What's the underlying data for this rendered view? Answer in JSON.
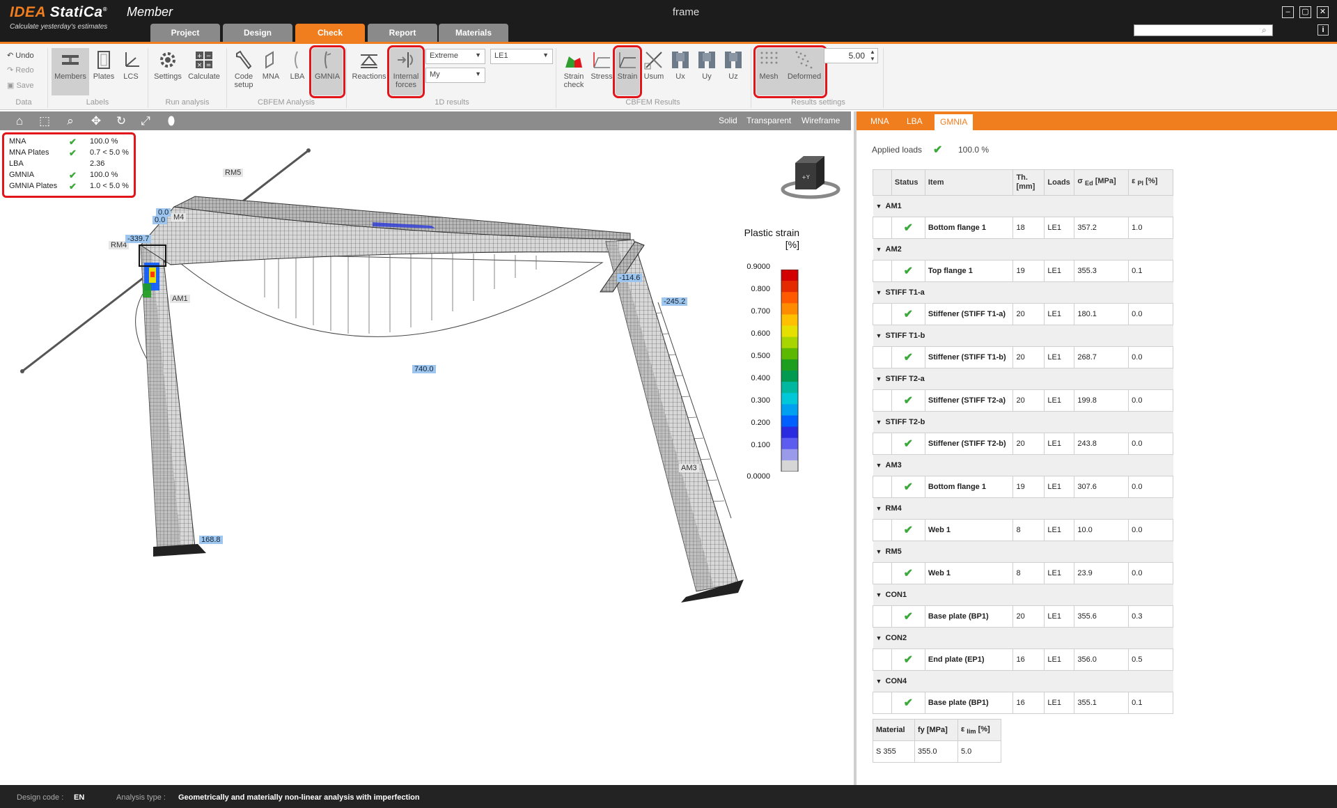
{
  "titlebar": {
    "brand_idea": "IDEA",
    "brand_statica": "StatiCa",
    "product": "Member",
    "slogan": "Calculate yesterday's estimates",
    "window_title": "frame",
    "search_placeholder": ""
  },
  "tabs": [
    {
      "label": "Project"
    },
    {
      "label": "Design"
    },
    {
      "label": "Check",
      "active": true
    },
    {
      "label": "Report"
    },
    {
      "label": "Materials"
    }
  ],
  "ribbon": {
    "data": {
      "undo": "Undo",
      "redo": "Redo",
      "save": "Save",
      "group": "Data"
    },
    "labels": {
      "members": "Members",
      "plates": "Plates",
      "lcs": "LCS",
      "group": "Labels"
    },
    "run": {
      "settings": "Settings",
      "calculate": "Calculate",
      "group": "Run analysis"
    },
    "cbfem": {
      "code_setup_1": "Code",
      "code_setup_2": "setup",
      "mna": "MNA",
      "lba": "LBA",
      "gmnia": "GMNIA",
      "group": "CBFEM Analysis"
    },
    "results1d": {
      "reactions": "Reactions",
      "internal_1": "Internal",
      "internal_2": "forces",
      "select_extreme": "Extreme",
      "select_my": "My",
      "select_le": "LE1",
      "group": "1D results"
    },
    "cbfem_results": {
      "strain_check_1": "Strain",
      "strain_check_2": "check",
      "stress": "Stress",
      "strain": "Strain",
      "usum": "Usum",
      "ux": "Ux",
      "uy": "Uy",
      "uz": "Uz",
      "group": "CBFEM Results"
    },
    "settings": {
      "mesh": "Mesh",
      "deformed": "Deformed",
      "value": "5.00",
      "group": "Results settings"
    }
  },
  "view_modes": {
    "solid": "Solid",
    "transparent": "Transparent",
    "wireframe": "Wireframe"
  },
  "summary": [
    {
      "label": "MNA",
      "value": "100.0 %",
      "ok": true
    },
    {
      "label": "MNA Plates",
      "value": "0.7 < 5.0 %",
      "ok": true
    },
    {
      "label": "LBA",
      "value": "2.36",
      "ok": false
    },
    {
      "label": "GMNIA",
      "value": "100.0 %",
      "ok": true
    },
    {
      "label": "GMNIA Plates",
      "value": "1.0 < 5.0 %",
      "ok": true
    }
  ],
  "viewport_labels": {
    "rm5": "RM5",
    "rm4": "RM4",
    "am1": "AM1",
    "am3": "AM3",
    "m4": "M4",
    "v_00a": "0.0",
    "v_00b": "0.0",
    "v_339": "-339.7",
    "v_740": "740.0",
    "v_114": "-114.6",
    "v_245": "-245.2",
    "v_168": "168.8"
  },
  "navcube_label": "+Y",
  "legend": {
    "title_1": "Plastic strain",
    "title_2": "[%]",
    "ticks": [
      "0.9000",
      "0.800",
      "0.700",
      "0.600",
      "0.500",
      "0.400",
      "0.300",
      "0.200",
      "0.100",
      "0.0000"
    ],
    "colors": [
      "#d20000",
      "#e62a00",
      "#ff5a00",
      "#ff8c00",
      "#ffc000",
      "#e6e000",
      "#a8d400",
      "#5cb800",
      "#1e9e1e",
      "#009a50",
      "#00b8a0",
      "#00c8d8",
      "#00a0f0",
      "#0060ff",
      "#2a2ae0",
      "#5c5cf0",
      "#9a9aea",
      "#d6d6d6"
    ]
  },
  "right_panel": {
    "tabs": [
      "MNA",
      "LBA",
      "GMNIA"
    ],
    "applied_label": "Applied loads",
    "applied_value": "100.0 %",
    "headers": {
      "status": "Status",
      "item": "Item",
      "th_1": "Th.",
      "th_2": "[mm]",
      "loads": "Loads",
      "sigma": "σ",
      "sigma_sub": "Ed",
      "sigma_unit": "[MPa]",
      "eps": "ε",
      "eps_sub": "Pl",
      "eps_unit": "[%]"
    },
    "groups": [
      {
        "name": "AM1",
        "item": "Bottom flange 1",
        "th": "18",
        "loads": "LE1",
        "sigma": "357.2",
        "eps": "1.0"
      },
      {
        "name": "AM2",
        "item": "Top flange 1",
        "th": "19",
        "loads": "LE1",
        "sigma": "355.3",
        "eps": "0.1"
      },
      {
        "name": "STIFF T1-a",
        "item": "Stiffener (STIFF T1-a)",
        "th": "20",
        "loads": "LE1",
        "sigma": "180.1",
        "eps": "0.0"
      },
      {
        "name": "STIFF T1-b",
        "item": "Stiffener (STIFF T1-b)",
        "th": "20",
        "loads": "LE1",
        "sigma": "268.7",
        "eps": "0.0"
      },
      {
        "name": "STIFF T2-a",
        "item": "Stiffener (STIFF T2-a)",
        "th": "20",
        "loads": "LE1",
        "sigma": "199.8",
        "eps": "0.0"
      },
      {
        "name": "STIFF T2-b",
        "item": "Stiffener (STIFF T2-b)",
        "th": "20",
        "loads": "LE1",
        "sigma": "243.8",
        "eps": "0.0"
      },
      {
        "name": "AM3",
        "item": "Bottom flange 1",
        "th": "19",
        "loads": "LE1",
        "sigma": "307.6",
        "eps": "0.0"
      },
      {
        "name": "RM4",
        "item": "Web 1",
        "th": "8",
        "loads": "LE1",
        "sigma": "10.0",
        "eps": "0.0"
      },
      {
        "name": "RM5",
        "item": "Web 1",
        "th": "8",
        "loads": "LE1",
        "sigma": "23.9",
        "eps": "0.0"
      },
      {
        "name": "CON1",
        "item": "Base plate (BP1)",
        "th": "20",
        "loads": "LE1",
        "sigma": "355.6",
        "eps": "0.3"
      },
      {
        "name": "CON2",
        "item": "End plate (EP1)",
        "th": "16",
        "loads": "LE1",
        "sigma": "356.0",
        "eps": "0.5"
      },
      {
        "name": "CON4",
        "item": "Base plate (BP1)",
        "th": "16",
        "loads": "LE1",
        "sigma": "355.1",
        "eps": "0.1"
      }
    ],
    "materials": {
      "h_material": "Material",
      "h_fy": "fy [MPa]",
      "h_elim": "ε",
      "h_elim_sub": "lim",
      "h_elim_unit": "[%]",
      "material": "S 355",
      "fy": "355.0",
      "elim": "5.0"
    }
  },
  "statusbar": {
    "design_code_label": "Design code :",
    "design_code": "EN",
    "analysis_label": "Analysis type :",
    "analysis": "Geometrically and materially non-linear analysis with imperfection"
  },
  "colors": {
    "accent": "#f07d1e",
    "highlight": "#e2151b",
    "ok": "#3aa83a",
    "dark": "#1c1c1c"
  }
}
